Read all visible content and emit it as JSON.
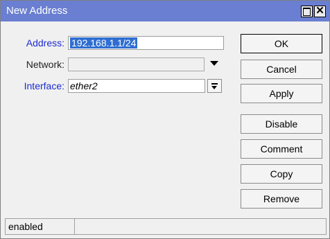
{
  "window": {
    "title": "New Address",
    "accent_color": "#6a7fd1",
    "maximize_icon": "maximize-icon",
    "close_icon": "close-icon",
    "close_glyph": "✕"
  },
  "form": {
    "address": {
      "label": "Address:",
      "value": "192.168.1.1/24",
      "selected": true
    },
    "network": {
      "label": "Network:",
      "value": "",
      "icon": "dropdown-arrow-icon"
    },
    "interface": {
      "label": "Interface:",
      "value": "ether2",
      "icon": "dropdown-icon"
    }
  },
  "buttons": {
    "ok": "OK",
    "cancel": "Cancel",
    "apply": "Apply",
    "disable": "Disable",
    "comment": "Comment",
    "copy": "Copy",
    "remove": "Remove"
  },
  "status": {
    "text": "enabled"
  }
}
